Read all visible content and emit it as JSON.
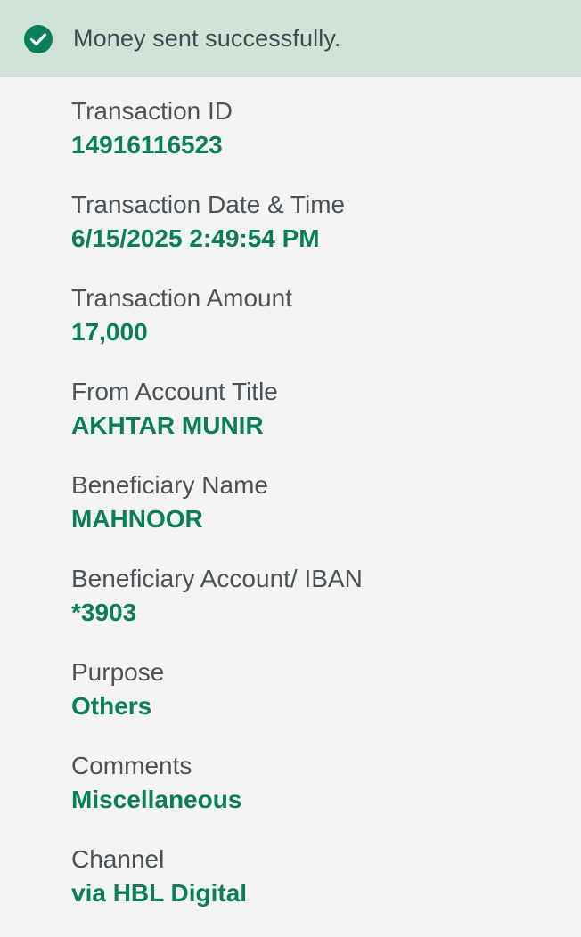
{
  "banner": {
    "icon": "check-circle-icon",
    "message": "Money sent successfully.",
    "background": "#cfe3d6",
    "icon_color": "#0a7d5a"
  },
  "details": [
    {
      "label": "Transaction ID",
      "value": "14916116523"
    },
    {
      "label": "Transaction Date & Time",
      "value": "6/15/2025 2:49:54 PM"
    },
    {
      "label": "Transaction Amount",
      "value": "17,000"
    },
    {
      "label": "From Account Title",
      "value": "AKHTAR MUNIR"
    },
    {
      "label": "Beneficiary Name",
      "value": "MAHNOOR"
    },
    {
      "label": "Beneficiary Account/ IBAN",
      "value": "*3903"
    },
    {
      "label": "Purpose",
      "value": "Others"
    },
    {
      "label": "Comments",
      "value": "Miscellaneous"
    },
    {
      "label": "Channel",
      "value": "via HBL Digital"
    }
  ],
  "colors": {
    "value_text": "#0a7d5a",
    "label_text": "#4a5257",
    "page_background": "#f4f4f4"
  }
}
